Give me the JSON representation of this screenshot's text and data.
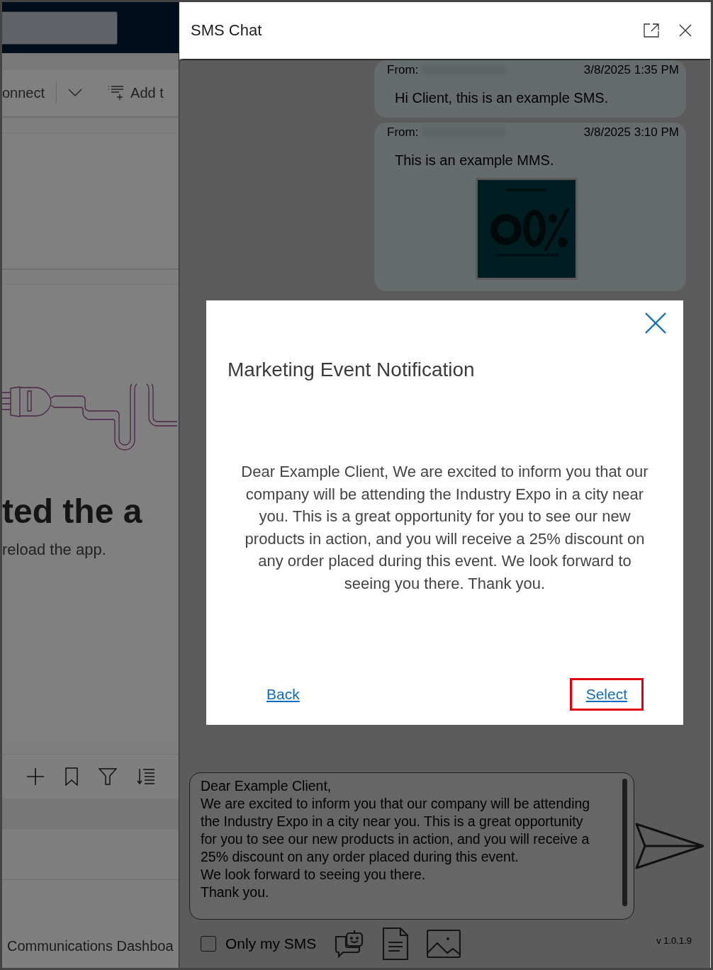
{
  "background_app": {
    "command_bar": [
      {
        "label": "onnect",
        "kind": "split"
      },
      {
        "label": "Add t",
        "kind": "add"
      }
    ],
    "error": {
      "heading": "ted the a",
      "message": "reload the app."
    },
    "footer": "Communications Dashboa"
  },
  "panel": {
    "title": "SMS Chat",
    "messages": [
      {
        "from_label": "From:",
        "time": "3/8/2025 1:35 PM",
        "text": "Hi Client, this is an example SMS."
      },
      {
        "from_label": "From:",
        "time": "3/8/2025 3:10 PM",
        "text": "This is an example MMS."
      }
    ],
    "composer": {
      "value": "Dear Example Client,\nWe are excited to inform you that our company will be attending the Industry Expo in a city near you. This is a great opportunity for you to see our new products in action, and you will receive a 25% discount on any order placed during this event.\nWe look forward to seeing you there.\nThank you."
    },
    "only_my_sms": {
      "label": "Only my SMS",
      "checked": false
    },
    "version": "v 1.0.1.9"
  },
  "dialog": {
    "title": "Marketing Event Notification",
    "body": "Dear Example Client, We are excited to inform you that our company will be attending the Industry Expo in a city near you. This is a great opportunity for you to see our new products in action, and you will receive a 25% discount on any order placed during this event. We look forward to seeing you there. Thank you.",
    "buttons": [
      {
        "label": "Back",
        "focused": false
      },
      {
        "label": "Select",
        "focused": true
      }
    ]
  }
}
